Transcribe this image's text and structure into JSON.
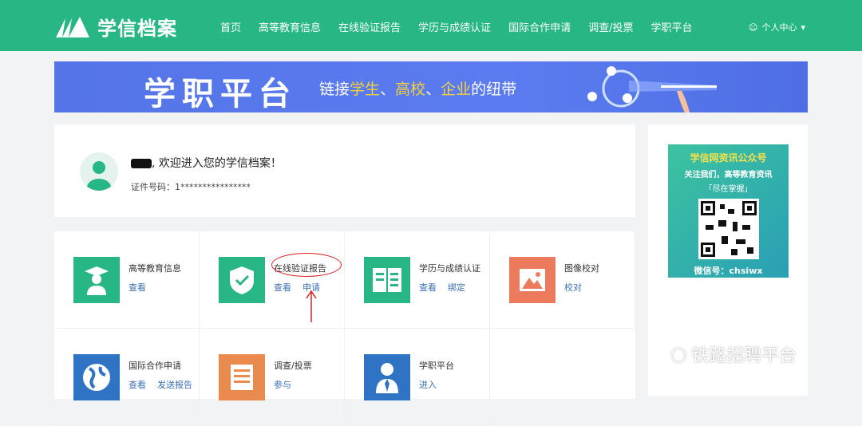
{
  "header": {
    "logo": "学信档案",
    "nav": [
      "首页",
      "高等教育信息",
      "在线验证报告",
      "学历与成绩认证",
      "国际合作申请",
      "调查/投票",
      "学职平台"
    ],
    "user": "个人中心"
  },
  "banner": {
    "title": "学职平台",
    "sub_pre": "链接",
    "s1": "学生",
    "sep1": "、",
    "s2": "高校",
    "sep2": "、",
    "s3": "企业",
    "sub_post": "的纽带"
  },
  "welcome": {
    "text": ", 欢迎进入您的学信档案！",
    "id_label": "证件号码：",
    "id_value": "1****************"
  },
  "services": [
    {
      "title": "高等教育信息",
      "links": [
        "查看"
      ],
      "color": "#27b784",
      "icon": "graduate-icon"
    },
    {
      "title": "在线验证报告",
      "links": [
        "查看",
        "申请"
      ],
      "color": "#27b784",
      "icon": "shield-check-icon"
    },
    {
      "title": "学历与成绩认证",
      "links": [
        "查看",
        "绑定"
      ],
      "color": "#27b784",
      "icon": "book-icon"
    },
    {
      "title": "图像校对",
      "links": [
        "校对"
      ],
      "color": "#ec7a5c",
      "icon": "image-icon"
    },
    {
      "title": "国际合作申请",
      "links": [
        "查看",
        "发送报告"
      ],
      "color": "#2f74c4",
      "icon": "globe-icon"
    },
    {
      "title": "调查/投票",
      "links": [
        "参与"
      ],
      "color": "#ea8a4e",
      "icon": "list-icon"
    },
    {
      "title": "学职平台",
      "links": [
        "进入"
      ],
      "color": "#2f74c4",
      "icon": "person-icon"
    }
  ],
  "wechat": {
    "title": "学信网资讯公众号",
    "line2": "关注我们，高等教育资讯",
    "line3": "「尽在掌握」",
    "id": "微信号：chsiwx"
  },
  "watermark": "铁路招聘平台"
}
